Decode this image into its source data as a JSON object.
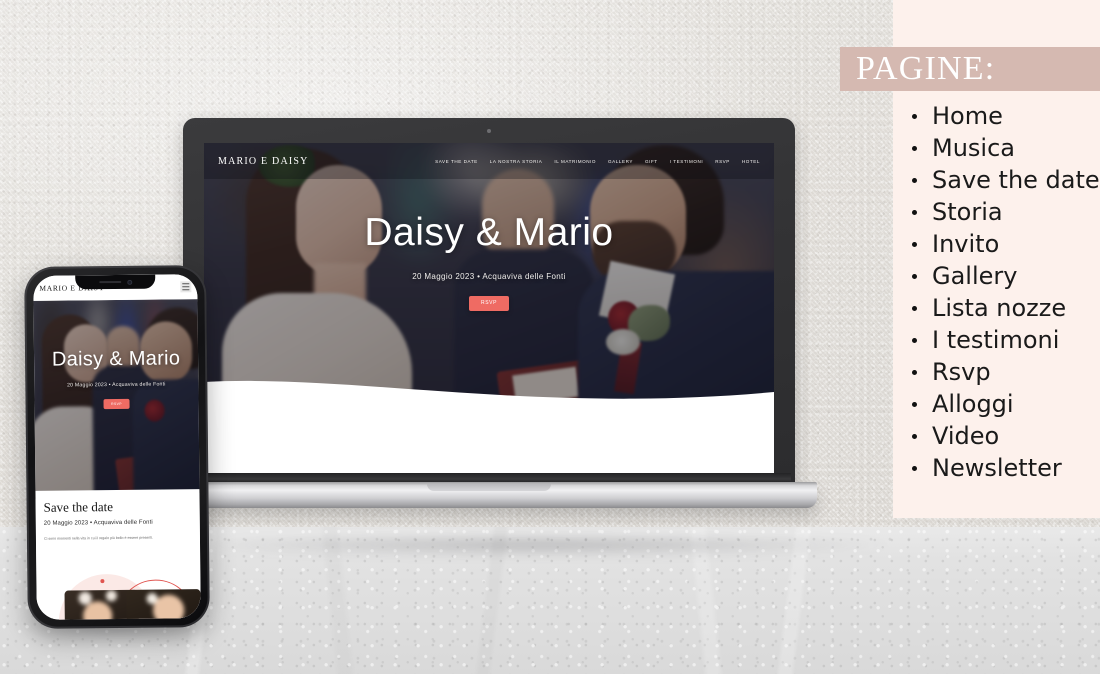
{
  "side_panel": {
    "heading": "PAGINE:",
    "band_color": "#d5b9b1",
    "panel_color": "#fdf1ec",
    "items": [
      {
        "label": "Home"
      },
      {
        "label": "Musica"
      },
      {
        "label": "Save the date"
      },
      {
        "label": "Storia"
      },
      {
        "label": "Invito"
      },
      {
        "label": "Gallery"
      },
      {
        "label": "Lista nozze"
      },
      {
        "label": "I testimoni"
      },
      {
        "label": "Rsvp"
      },
      {
        "label": "Alloggi"
      },
      {
        "label": "Video"
      },
      {
        "label": "Newsletter"
      }
    ]
  },
  "laptop": {
    "site": {
      "logo": "MARIO E DAISY",
      "nav": [
        {
          "label": "SAVE THE DATE"
        },
        {
          "label": "LA NOSTRA STORIA"
        },
        {
          "label": "IL MATRIMONIO"
        },
        {
          "label": "GALLERY"
        },
        {
          "label": "GIFT"
        },
        {
          "label": "I TESTIMONI"
        },
        {
          "label": "RSVP"
        },
        {
          "label": "HOTEL"
        }
      ],
      "hero": {
        "title": "Daisy & Mario",
        "subtitle": "20 Maggio 2023 • Acquaviva delle Fonti",
        "cta_label": "RSVP",
        "cta_color": "#ef6b63"
      }
    }
  },
  "phone": {
    "site": {
      "logo": "MARIO E DAISY",
      "menu_icon": "hamburger-icon",
      "hero": {
        "title": "Daisy & Mario",
        "subtitle": "20 Maggio 2023 • Acquaviva delle Fonti",
        "cta_label": "RSVP",
        "cta_color": "#ef6b63"
      },
      "section": {
        "title": "Save the date",
        "subtitle": "20 Maggio 2023 • Acquaviva delle Fonti",
        "body": "Ci sono momenti nella vita in cui il regalo più bello è essere presenti."
      }
    }
  }
}
